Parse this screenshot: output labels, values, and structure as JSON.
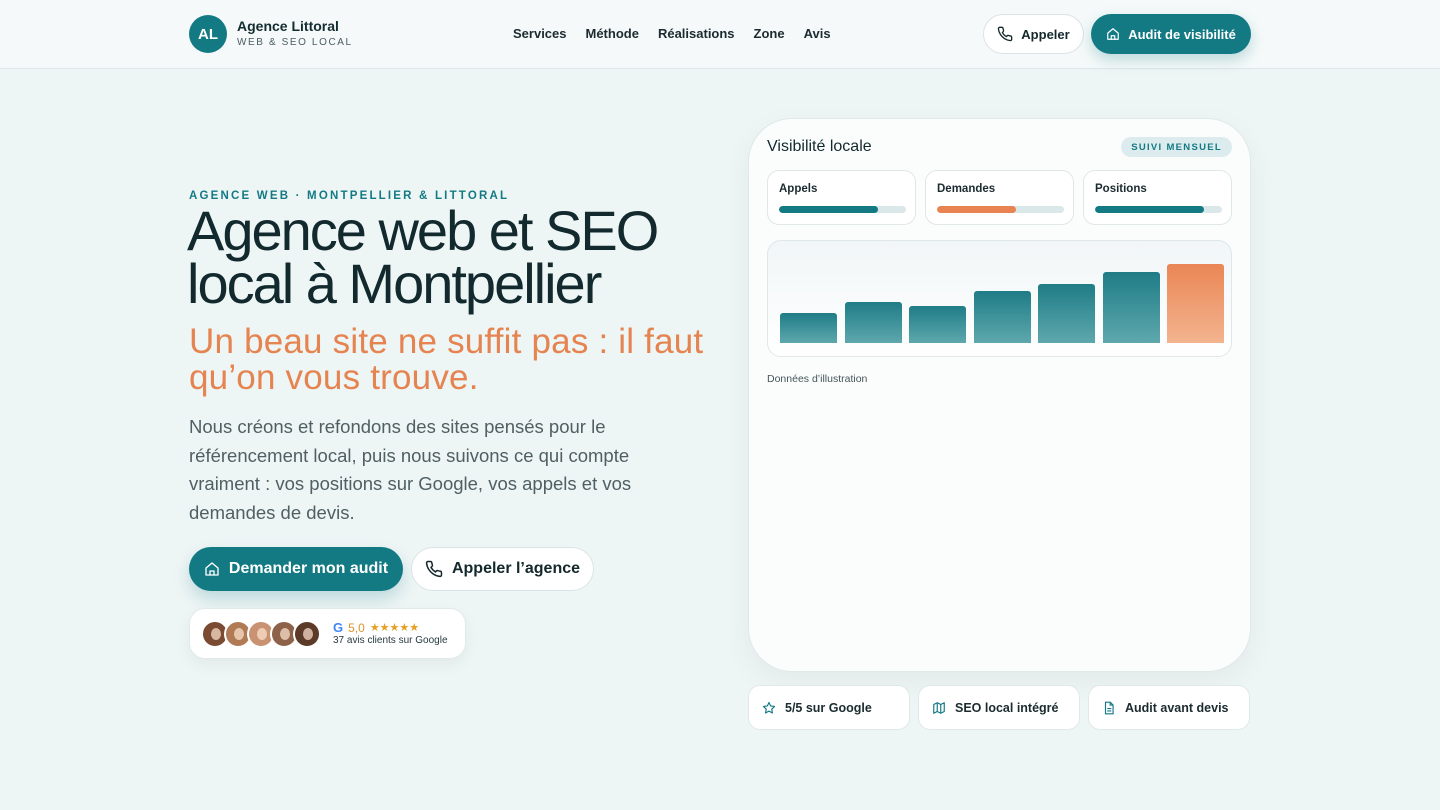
{
  "header": {
    "logo_initials": "AL",
    "logo_name": "Agence Littoral",
    "logo_tagline": "WEB & SEO LOCAL",
    "nav": [
      "Services",
      "Méthode",
      "Réalisations",
      "Zone",
      "Avis"
    ],
    "call_label": "Appeler",
    "audit_label": "Audit de visibilité"
  },
  "hero": {
    "eyebrow": "AGENCE WEB · MONTPELLIER & LITTORAL",
    "title_line1": "Agence web et SEO",
    "title_line2": "local à Montpellier",
    "subtitle": "Un beau site ne suffit pas : il faut qu’on vous trouve.",
    "description": "Nous créons et refondons des sites pensés pour le référencement local, puis nous suivons ce qui compte vraiment : vos positions sur Google, vos appels et vos demandes de devis.",
    "cta_primary": "Demander mon audit",
    "cta_secondary": "Appeler l’agence",
    "reviews": {
      "rating": "5,0",
      "stars": "★★★★★",
      "count_text": "37 avis clients sur Google",
      "google_icon": "G"
    }
  },
  "card": {
    "title": "Visibilité locale",
    "badge": "SUIVI MENSUEL",
    "metrics": [
      {
        "label": "Appels",
        "value": 0.78,
        "color": "#137a84"
      },
      {
        "label": "Demandes",
        "value": 0.62,
        "color": "#ea8352"
      },
      {
        "label": "Positions",
        "value": 0.86,
        "color": "#137a84"
      }
    ],
    "bars": [
      {
        "value": 30,
        "color": "teal"
      },
      {
        "value": 41,
        "color": "teal"
      },
      {
        "value": 37,
        "color": "teal"
      },
      {
        "value": 52,
        "color": "teal"
      },
      {
        "value": 59,
        "color": "teal"
      },
      {
        "value": 71,
        "color": "teal"
      },
      {
        "value": 79,
        "color": "orange"
      }
    ],
    "note": "Données d’illustration"
  },
  "features": [
    {
      "label": "5/5 sur Google",
      "icon": "star-icon"
    },
    {
      "label": "SEO local intégré",
      "icon": "map-icon"
    },
    {
      "label": "Audit avant devis",
      "icon": "document-icon"
    }
  ],
  "colors": {
    "accent": "#137a84",
    "orange": "#e58450",
    "background": "#eef5f5"
  }
}
